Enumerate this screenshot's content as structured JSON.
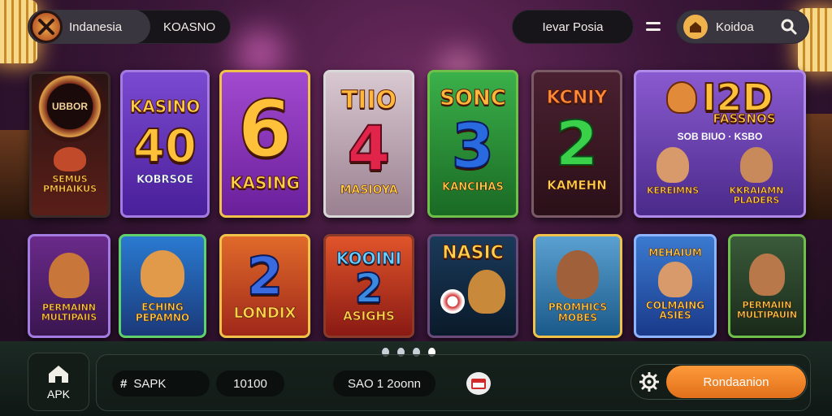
{
  "header": {
    "region_label": "Indanesia",
    "brand_label": "KOASNO",
    "search_label": "Ievar Posia",
    "account_label": "Koidoa"
  },
  "cards_row1": [
    {
      "title": "UBBOR",
      "caption": "SEMUS PMHAIKUS",
      "accent": "#c9a46a"
    },
    {
      "title": "KASINO",
      "number": "40",
      "caption": "KOBRSOE",
      "accent": "#a47be0"
    },
    {
      "number": "6",
      "caption": "KASING",
      "accent": "#f0c24a"
    },
    {
      "title": "TIIO",
      "number": "4",
      "caption": "MASIOYA",
      "accent": "#d8d8d8"
    },
    {
      "title": "SONC",
      "number": "3",
      "caption": "KANCIHAS",
      "accent": "#6fbf4a"
    },
    {
      "title": "KCNIY",
      "number": "2",
      "caption": "KAMEHN",
      "accent": "#7a5a64"
    },
    {
      "title": "I2D",
      "subtitle": "FASSNOS",
      "line": "SOB BIUO · KSBO",
      "caption_left": "KEREIMNS",
      "caption_right": "KKRAIAMN PLADERS",
      "accent": "#b08ae8"
    }
  ],
  "cards_row2": [
    {
      "caption": "PERMAINN MULTIPAIIS",
      "accent": "#a47be0"
    },
    {
      "caption": "ECHING PEPAMNO",
      "accent": "#5fd06a"
    },
    {
      "number": "2",
      "caption": "LONDIX",
      "accent": "#f0c24a"
    },
    {
      "title": "KOOINI",
      "number": "2",
      "caption": "ASIGHS",
      "accent": "#8a3a2a"
    },
    {
      "title": "NASIC",
      "accent": "#6a4a7a"
    },
    {
      "caption": "PROMHICS MOBES",
      "accent": "#f0c24a"
    },
    {
      "title": "MEHAIUM",
      "caption": "COLMAING ASIES",
      "accent": "#8fb4ff"
    },
    {
      "caption": "PERMAIIN MULTIPAUIN",
      "accent": "#6fbf4a"
    }
  ],
  "pagination": {
    "count": 4,
    "active": 3
  },
  "bottom": {
    "home_label": "APK",
    "apk_label": "SAPK",
    "apk_prefix": "#",
    "value1": "10100",
    "value2": "SAO 1 2oonn",
    "action_label": "Rondaanion"
  },
  "colors": {
    "action": "#f0832a",
    "bar": "#1c2a24"
  }
}
